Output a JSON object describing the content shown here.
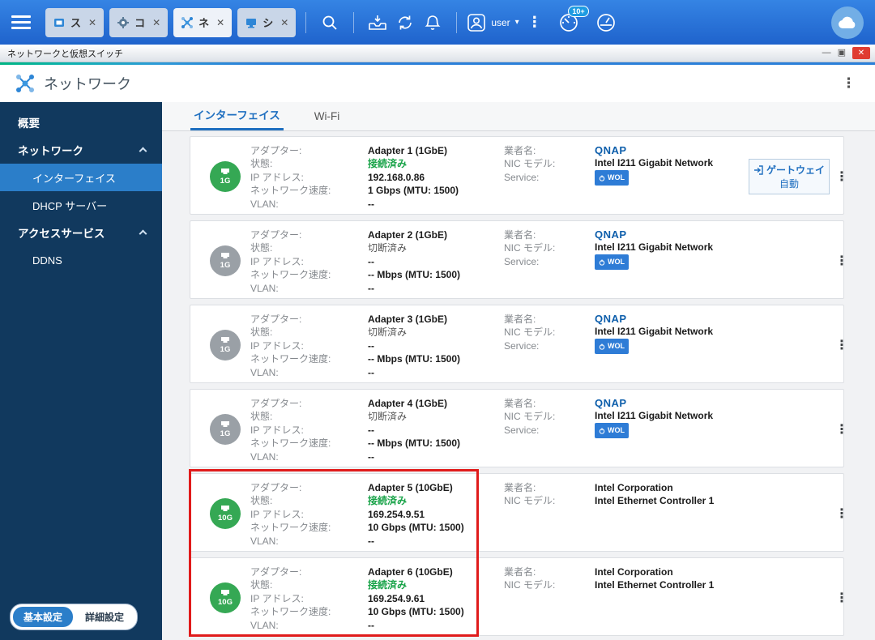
{
  "taskbar": {
    "tabs": [
      {
        "label": "ス"
      },
      {
        "label": "コ"
      },
      {
        "label": "ネ"
      },
      {
        "label": "シ"
      }
    ],
    "user_label": "user",
    "notification_badge": "10+"
  },
  "window": {
    "title": "ネットワークと仮想スイッチ"
  },
  "app_header": {
    "title": "ネットワーク"
  },
  "sidebar": {
    "items": [
      {
        "label": "概要"
      },
      {
        "label": "ネットワーク"
      },
      {
        "label": "インターフェイス"
      },
      {
        "label": "DHCP サーバー"
      },
      {
        "label": "アクセスサービス"
      },
      {
        "label": "DDNS"
      }
    ],
    "footer": {
      "basic": "基本設定",
      "advanced": "詳細設定"
    }
  },
  "main": {
    "tabs": [
      {
        "label": "インターフェイス"
      },
      {
        "label": "Wi-Fi"
      }
    ],
    "labels": {
      "adapter": "アダプター:",
      "status": "状態:",
      "ip": "IP アドレス:",
      "speed": "ネットワーク速度:",
      "vlan": "VLAN:",
      "vendor": "業者名:",
      "nic": "NIC モデル:",
      "service": "Service:"
    },
    "wol_label": "WOL",
    "gateway": {
      "label": "ゲートウェイ",
      "value": "自動"
    },
    "adapters": [
      {
        "badge": "1G",
        "name": "Adapter 1 (1GbE)",
        "status": "接続済み",
        "ip": "192.168.0.86",
        "speed": "1 Gbps (MTU: 1500)",
        "vlan": "--",
        "vendor": "QNAP",
        "nic": "Intel I211 Gigabit Network"
      },
      {
        "badge": "1G",
        "name": "Adapter 2 (1GbE)",
        "status": "切断済み",
        "ip": "--",
        "speed": "-- Mbps (MTU: 1500)",
        "vlan": "--",
        "vendor": "QNAP",
        "nic": "Intel I211 Gigabit Network"
      },
      {
        "badge": "1G",
        "name": "Adapter 3 (1GbE)",
        "status": "切断済み",
        "ip": "--",
        "speed": "-- Mbps (MTU: 1500)",
        "vlan": "--",
        "vendor": "QNAP",
        "nic": "Intel I211 Gigabit Network"
      },
      {
        "badge": "1G",
        "name": "Adapter 4 (1GbE)",
        "status": "切断済み",
        "ip": "--",
        "speed": "-- Mbps (MTU: 1500)",
        "vlan": "--",
        "vendor": "QNAP",
        "nic": "Intel I211 Gigabit Network"
      },
      {
        "badge": "10G",
        "name": "Adapter 5 (10GbE)",
        "status": "接続済み",
        "ip": "169.254.9.51",
        "speed": "10 Gbps (MTU: 1500)",
        "vlan": "--",
        "vendor": "Intel Corporation",
        "nic": "Intel Ethernet Controller 1"
      },
      {
        "badge": "10G",
        "name": "Adapter 6 (10GbE)",
        "status": "接続済み",
        "ip": "169.254.9.61",
        "speed": "10 Gbps (MTU: 1500)",
        "vlan": "--",
        "vendor": "Intel Corporation",
        "nic": "Intel Ethernet Controller 1"
      }
    ]
  }
}
